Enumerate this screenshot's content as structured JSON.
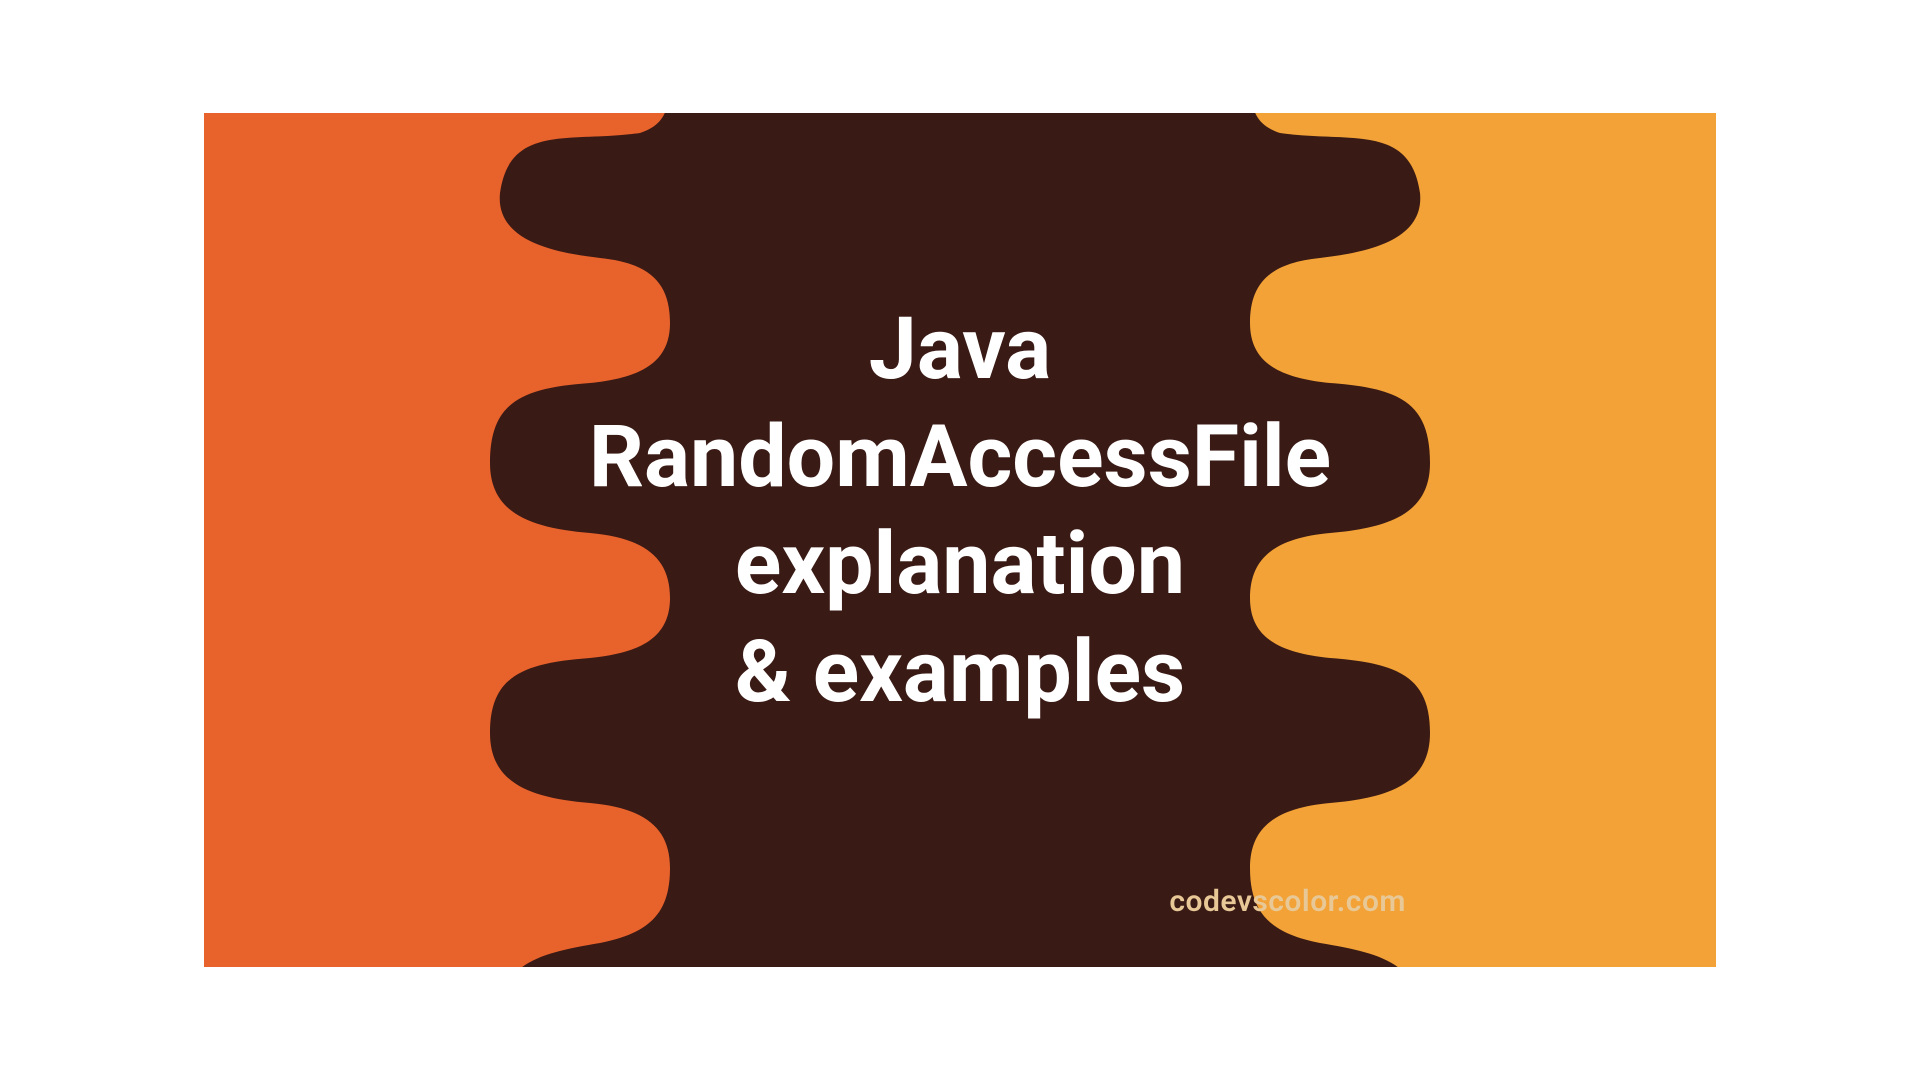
{
  "title": {
    "line1": "Java",
    "line2": "RandomAccessFile",
    "line3": "explanation",
    "line4": "& examples"
  },
  "watermark": "codevscolor.com",
  "colors": {
    "bg_left": "#E8622C",
    "bg_right": "#F2A236",
    "blob": "#3A1A15",
    "text": "#ffffff",
    "watermark": "#E8C896"
  }
}
